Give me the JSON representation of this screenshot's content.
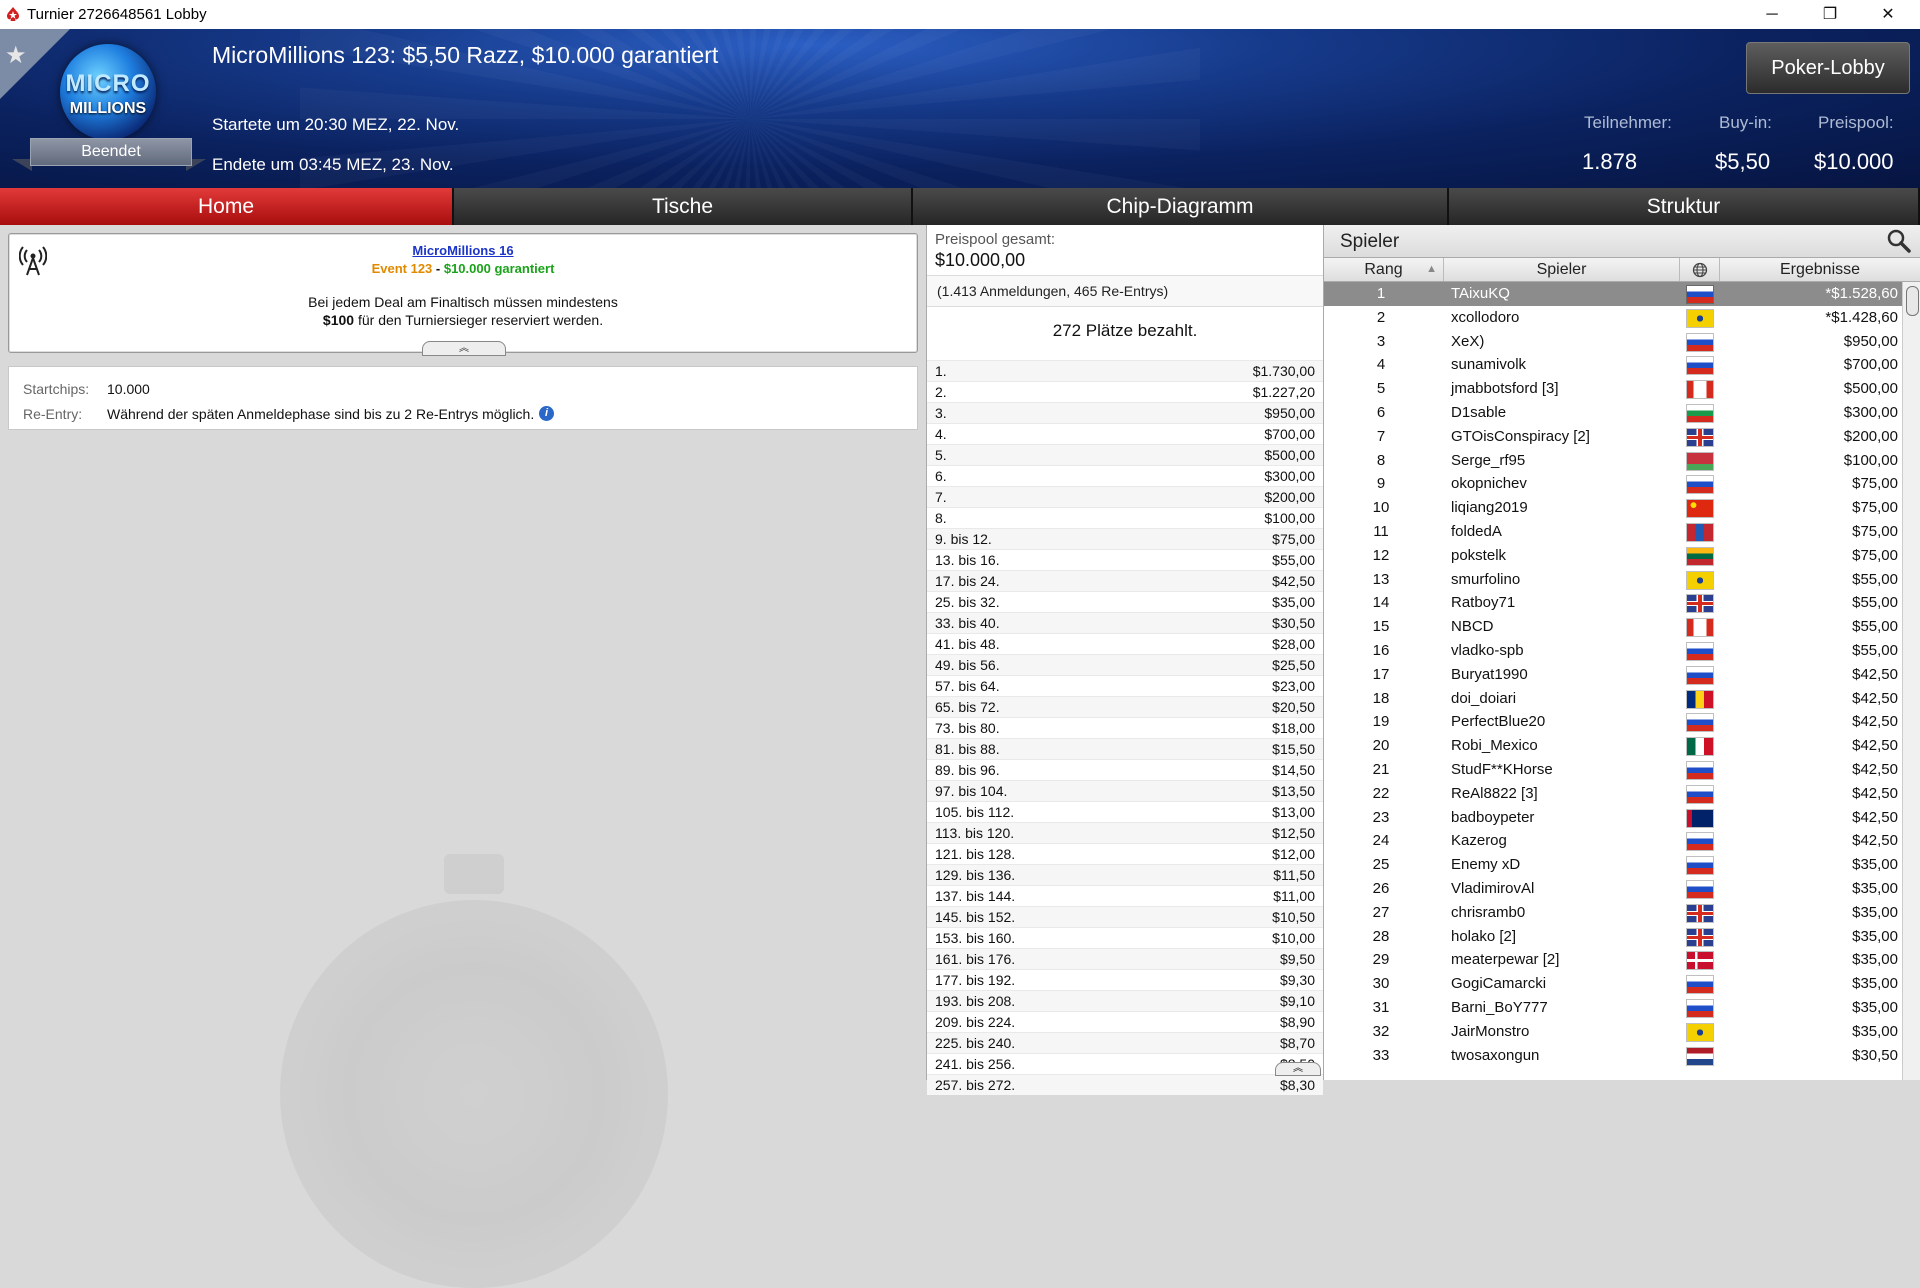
{
  "window": {
    "title": "Turnier 2726648561 Lobby",
    "minimize_glyph": "─",
    "maximize_glyph": "❐",
    "close_glyph": "✕"
  },
  "header": {
    "logo_line1": "MICRO",
    "logo_line2": "MILLIONS",
    "status": "Beendet",
    "tournament_name": "MicroMillions 123: $5,50 Razz, $10.000 garantiert",
    "started": "Startete um 20:30 MEZ, 22. Nov.",
    "ended": "Endete um 03:45 MEZ, 23. Nov.",
    "lobby_button": "Poker-Lobby",
    "stats": {
      "participants_label": "Teilnehmer:",
      "participants_value": "1.878",
      "buyin_label": "Buy-in:",
      "buyin_value": "$5,50",
      "prizepool_label": "Preispool:",
      "prizepool_value": "$10.000"
    }
  },
  "tabs": [
    "Home",
    "Tische",
    "Chip-Diagramm",
    "Struktur"
  ],
  "infobox": {
    "series_link": "MicroMillions 16",
    "event_text": "Event 123",
    "event_sep": " - ",
    "guarantee_text": "$10.000 garantiert",
    "message_line1": "Bei jedem Deal am Finaltisch müssen mindestens",
    "message_line2_bold": "$100",
    "message_line2_rest": " für den Turniersieger reserviert werden.",
    "collapse_glyph": "︽"
  },
  "details": {
    "startchips_label": "Startchips:",
    "startchips_value": "10.000",
    "reentry_label": "Re-Entry:",
    "reentry_value": "Während der späten Anmeldephase sind bis zu 2 Re-Entrys möglich.",
    "info_glyph": "i"
  },
  "prize": {
    "total_label": "Preispool gesamt:",
    "total_value": "$10.000,00",
    "entries": "(1.413 Anmeldungen, 465 Re-Entrys)",
    "paid_places": "272 Plätze bezahlt.",
    "collapse_glyph": "︽",
    "payouts": [
      {
        "place": "1.",
        "amount": "$1.730,00"
      },
      {
        "place": "2.",
        "amount": "$1.227,20"
      },
      {
        "place": "3.",
        "amount": "$950,00"
      },
      {
        "place": "4.",
        "amount": "$700,00"
      },
      {
        "place": "5.",
        "amount": "$500,00"
      },
      {
        "place": "6.",
        "amount": "$300,00"
      },
      {
        "place": "7.",
        "amount": "$200,00"
      },
      {
        "place": "8.",
        "amount": "$100,00"
      },
      {
        "place": "9. bis 12.",
        "amount": "$75,00"
      },
      {
        "place": "13. bis 16.",
        "amount": "$55,00"
      },
      {
        "place": "17. bis 24.",
        "amount": "$42,50"
      },
      {
        "place": "25. bis 32.",
        "amount": "$35,00"
      },
      {
        "place": "33. bis 40.",
        "amount": "$30,50"
      },
      {
        "place": "41. bis 48.",
        "amount": "$28,00"
      },
      {
        "place": "49. bis 56.",
        "amount": "$25,50"
      },
      {
        "place": "57. bis 64.",
        "amount": "$23,00"
      },
      {
        "place": "65. bis 72.",
        "amount": "$20,50"
      },
      {
        "place": "73. bis 80.",
        "amount": "$18,00"
      },
      {
        "place": "81. bis 88.",
        "amount": "$15,50"
      },
      {
        "place": "89. bis 96.",
        "amount": "$14,50"
      },
      {
        "place": "97. bis 104.",
        "amount": "$13,50"
      },
      {
        "place": "105. bis 112.",
        "amount": "$13,00"
      },
      {
        "place": "113. bis 120.",
        "amount": "$12,50"
      },
      {
        "place": "121. bis 128.",
        "amount": "$12,00"
      },
      {
        "place": "129. bis 136.",
        "amount": "$11,50"
      },
      {
        "place": "137. bis 144.",
        "amount": "$11,00"
      },
      {
        "place": "145. bis 152.",
        "amount": "$10,50"
      },
      {
        "place": "153. bis 160.",
        "amount": "$10,00"
      },
      {
        "place": "161. bis 176.",
        "amount": "$9,50"
      },
      {
        "place": "177. bis 192.",
        "amount": "$9,30"
      },
      {
        "place": "193. bis 208.",
        "amount": "$9,10"
      },
      {
        "place": "209. bis 224.",
        "amount": "$8,90"
      },
      {
        "place": "225. bis 240.",
        "amount": "$8,70"
      },
      {
        "place": "241. bis 256.",
        "amount": "$8,50"
      },
      {
        "place": "257. bis 272.",
        "amount": "$8,30"
      }
    ]
  },
  "players": {
    "title": "Spieler",
    "col_rank": "Rang",
    "col_player": "Spieler",
    "col_results": "Ergebnisse",
    "sort_glyph": "▲",
    "rows": [
      {
        "rank": "1",
        "name": "TAixuKQ",
        "country": "ru",
        "result": "*$1.528,60"
      },
      {
        "rank": "2",
        "name": "xcollodoro",
        "country": "br",
        "result": "*$1.428,60"
      },
      {
        "rank": "3",
        "name": "XeX)",
        "country": "ru",
        "result": "$950,00"
      },
      {
        "rank": "4",
        "name": "sunamivolk",
        "country": "ru",
        "result": "$700,00"
      },
      {
        "rank": "5",
        "name": "jmabbotsford [3]",
        "country": "ca",
        "result": "$500,00"
      },
      {
        "rank": "6",
        "name": "D1sable",
        "country": "bg",
        "result": "$300,00"
      },
      {
        "rank": "7",
        "name": "GTOisConspiracy [2]",
        "country": "gb",
        "result": "$200,00"
      },
      {
        "rank": "8",
        "name": "Serge_rf95",
        "country": "by",
        "result": "$100,00"
      },
      {
        "rank": "9",
        "name": "okopnichev",
        "country": "ru",
        "result": "$75,00"
      },
      {
        "rank": "10",
        "name": "liqiang2019",
        "country": "cn",
        "result": "$75,00"
      },
      {
        "rank": "11",
        "name": "foldedA",
        "country": "mn",
        "result": "$75,00"
      },
      {
        "rank": "12",
        "name": "pokstelk",
        "country": "lt",
        "result": "$75,00"
      },
      {
        "rank": "13",
        "name": "smurfolino",
        "country": "br",
        "result": "$55,00"
      },
      {
        "rank": "14",
        "name": "Ratboy71",
        "country": "gb",
        "result": "$55,00"
      },
      {
        "rank": "15",
        "name": "NBCD",
        "country": "ca",
        "result": "$55,00"
      },
      {
        "rank": "16",
        "name": "vladko-spb",
        "country": "ru",
        "result": "$55,00"
      },
      {
        "rank": "17",
        "name": "Buryat1990",
        "country": "ru",
        "result": "$42,50"
      },
      {
        "rank": "18",
        "name": "doi_doiari",
        "country": "ro",
        "result": "$42,50"
      },
      {
        "rank": "19",
        "name": "PerfectBlue20",
        "country": "ru",
        "result": "$42,50"
      },
      {
        "rank": "20",
        "name": "Robi_Mexico",
        "country": "mx",
        "result": "$42,50"
      },
      {
        "rank": "21",
        "name": "StudF**KHorse",
        "country": "ru",
        "result": "$42,50"
      },
      {
        "rank": "22",
        "name": "ReAl8822 [3]",
        "country": "ru",
        "result": "$42,50"
      },
      {
        "rank": "23",
        "name": "badboypeter",
        "country": "au",
        "result": "$42,50"
      },
      {
        "rank": "24",
        "name": "Kazerog",
        "country": "ru",
        "result": "$42,50"
      },
      {
        "rank": "25",
        "name": "Enemy xD",
        "country": "ru",
        "result": "$35,00"
      },
      {
        "rank": "26",
        "name": "VladimirovAl",
        "country": "ru",
        "result": "$35,00"
      },
      {
        "rank": "27",
        "name": "chrisramb0",
        "country": "gb",
        "result": "$35,00"
      },
      {
        "rank": "28",
        "name": "holako [2]",
        "country": "gb",
        "result": "$35,00"
      },
      {
        "rank": "29",
        "name": "meaterpewar [2]",
        "country": "dk",
        "result": "$35,00"
      },
      {
        "rank": "30",
        "name": "GogiCamarcki",
        "country": "ru",
        "result": "$35,00"
      },
      {
        "rank": "31",
        "name": "Barni_BoY777",
        "country": "ru",
        "result": "$35,00"
      },
      {
        "rank": "32",
        "name": "JairMonstro",
        "country": "br",
        "result": "$35,00"
      },
      {
        "rank": "33",
        "name": "twosaxongun",
        "country": "nl",
        "result": "$30,50"
      }
    ]
  },
  "colors": {
    "active_tab": "#c41e1e",
    "header_blue": "#0b2260",
    "link_blue": "#1c35c8",
    "event_orange": "#e08a00",
    "guarantee_green": "#1aa31a"
  },
  "icons": [
    "pokerstars-icon",
    "star-icon",
    "antenna-icon",
    "info-icon",
    "search-icon",
    "globe-icon",
    "sort-asc-icon"
  ]
}
